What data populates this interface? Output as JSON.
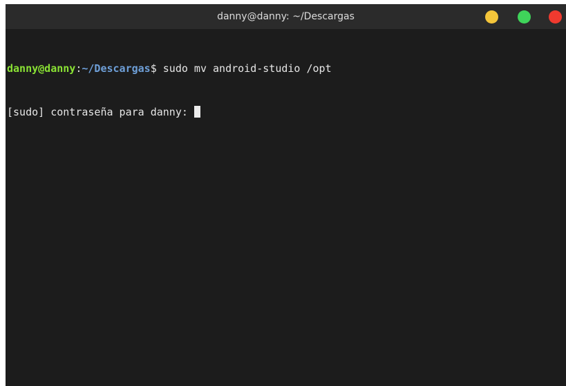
{
  "window": {
    "title": "danny@danny: ~/Descargas"
  },
  "controls": {
    "minimize_color": "#f4c53a",
    "maximize_color": "#3fd45a",
    "close_color": "#f03a2f"
  },
  "terminal": {
    "user_host": "danny@danny",
    "colon": ":",
    "path": "~/Descargas",
    "prompt_symbol": "$",
    "command": " sudo mv android-studio /opt",
    "password_prompt": "[sudo] contraseña para danny: ",
    "user_color": "#8ae234",
    "path_color": "#6e9fd8"
  }
}
